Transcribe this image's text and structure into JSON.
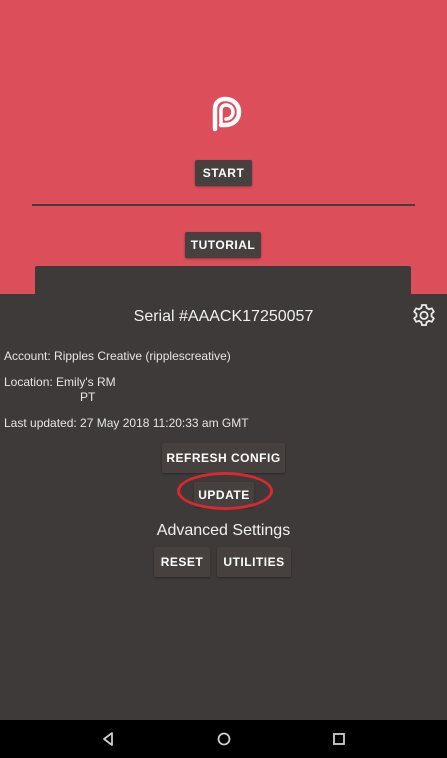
{
  "app": {
    "logo_icon": "ripples-logo-icon",
    "start_label": "START",
    "tutorial_label": "TUTORIAL"
  },
  "panel": {
    "serial_title": "Serial #AAACK17250057",
    "settings_icon": "gear-icon",
    "account_text": "Account: Ripples Creative (ripplescreative)",
    "location_label": "Location: Emily's RM",
    "location_cont": "PT",
    "last_updated_text": "Last updated: 27 May 2018 11:20:33 am GMT",
    "refresh_config_label": "REFRESH CONFIG",
    "update_label": "UPDATE",
    "advanced_settings_title": "Advanced Settings",
    "reset_label": "RESET",
    "utilities_label": "UTILITIES"
  },
  "navbar": {
    "back_icon": "back-triangle-icon",
    "home_icon": "home-circle-icon",
    "recents_icon": "recents-square-icon"
  },
  "colors": {
    "brand_background": "#dd4e5b",
    "panel_background": "#3e3a39",
    "button_background": "#46403f",
    "highlight_ring": "#d9282f"
  }
}
